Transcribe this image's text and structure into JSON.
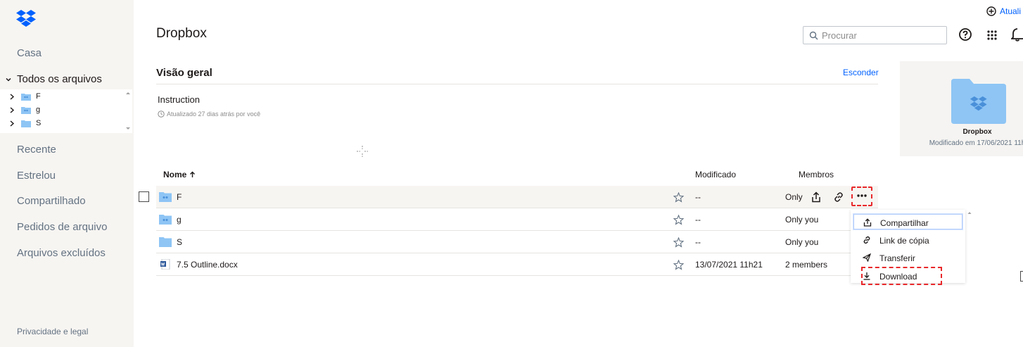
{
  "app": {
    "title": "Dropbox",
    "upgrade_label": "Atuali"
  },
  "sidebar": {
    "home": "Casa",
    "all_files": "Todos os arquivos",
    "tree": [
      {
        "label": "F"
      },
      {
        "label": "g"
      },
      {
        "label": "S"
      }
    ],
    "recent": "Recente",
    "starred": "Estrelou",
    "shared": "Compartilhado",
    "file_requests": "Pedidos de arquivo",
    "deleted": "Arquivos excluídos",
    "privacy": "Privacidade e legal"
  },
  "search": {
    "placeholder": "Procurar",
    "value": ""
  },
  "overview": {
    "title": "Visão geral",
    "hide_label": "Esconder",
    "description": "Instruction",
    "updated": "Atualizado 27 dias atrás por você"
  },
  "preview": {
    "name": "Dropbox",
    "modified": "Modificado em 17/06/2021 11h"
  },
  "table": {
    "col_name": "Nome",
    "col_modified": "Modificado",
    "col_members": "Membros",
    "rows": [
      {
        "name": "F",
        "modified": "--",
        "members": "Only"
      },
      {
        "name": "g",
        "modified": "--",
        "members": "Only you"
      },
      {
        "name": "S",
        "modified": "--",
        "members": "Only you"
      },
      {
        "name": "7.5 Outline.docx",
        "modified": "13/07/2021 11h21",
        "members": "2 members"
      }
    ]
  },
  "menu": {
    "share": "Compartilhar",
    "copy_link": "Link de cópia",
    "transfer": "Transferir",
    "download": "Download"
  },
  "colors": {
    "accent": "#0061fe",
    "folder": "#8ec5f5",
    "highlight_dashed": "#e8282b",
    "sidebar_bg": "#f7f5f2"
  },
  "icons": {
    "logo": "dropbox-logo-icon",
    "help": "help-icon",
    "apps": "apps-grid-icon",
    "notifications": "bell-icon"
  }
}
